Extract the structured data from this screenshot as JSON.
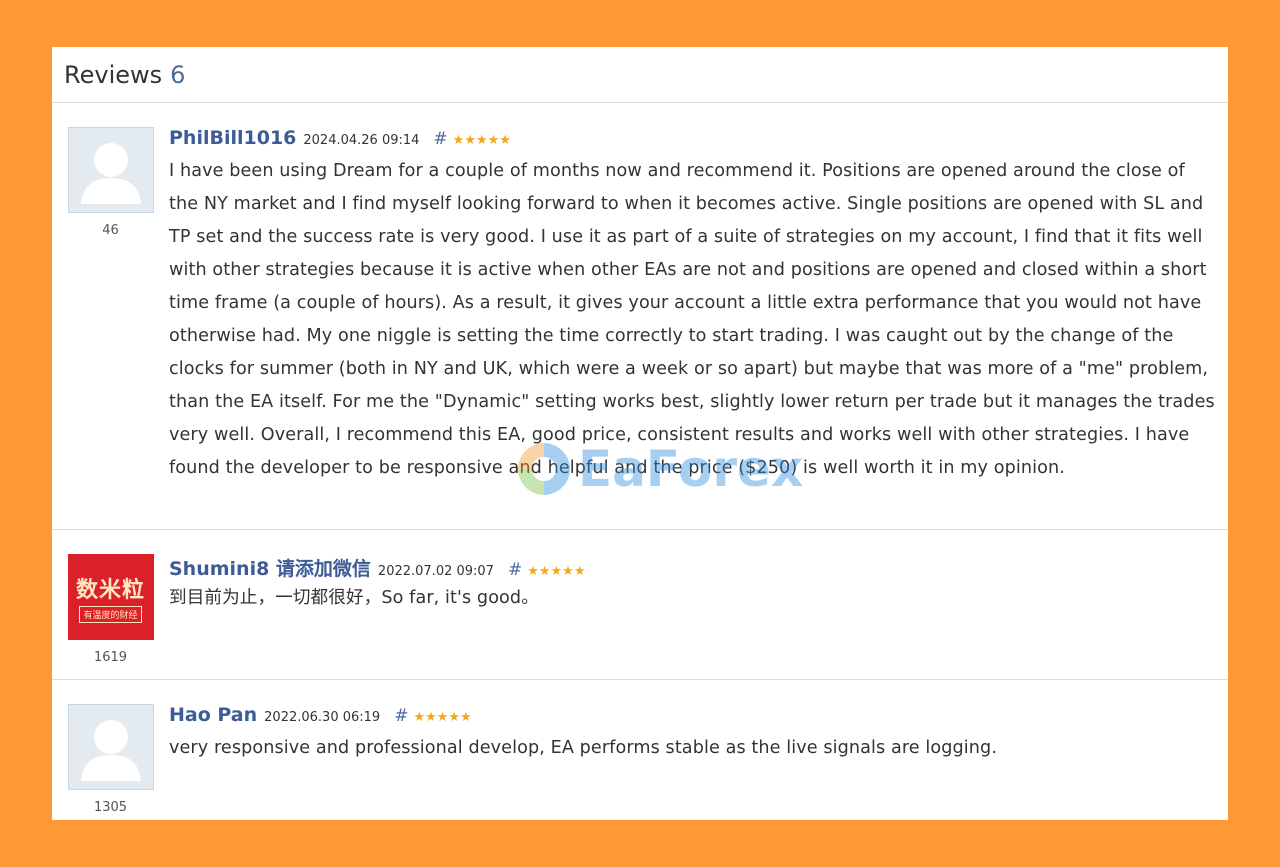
{
  "header": {
    "title": "Reviews",
    "count": "6"
  },
  "reviews": [
    {
      "author": "PhilBill1016",
      "date": "2024.04.26 09:14",
      "hash": "#",
      "stars": "★★★★★",
      "avatar_count": "46",
      "text": "I have been using Dream for a couple of months now and recommend it. Positions are opened around the close of the NY market and I find myself looking forward to when it becomes active. Single positions are opened with SL and TP set and the success rate is very good. I use it as part of a suite of strategies on my account, I find that it fits well with other strategies because it is active when other EAs are not and positions are opened and closed within a short time frame (a couple of hours). As a result, it gives your account a little extra performance that you would not have otherwise had. My one niggle is setting the time correctly to start trading. I was caught out by the change of the clocks for summer (both in NY and UK, which were a week or so apart) but maybe that was more of a \"me\" problem, than the EA itself. For me the \"Dynamic\" setting works best, slightly lower return per trade but it manages the trades very well. Overall, I recommend this EA, good price, consistent results and works well with other strategies. I have found the developer to be responsive and helpful and the price ($250) is well worth it in my opinion."
    },
    {
      "author": "Shumini8 请添加微信",
      "date": "2022.07.02 09:07",
      "hash": "#",
      "stars": "★★★★★",
      "avatar_count": "1619",
      "avatar_text_big": "数米粒",
      "avatar_text_small": "有温度的财经",
      "text": "到目前为止，一切都很好，So far, it's good。"
    },
    {
      "author": "Hao Pan",
      "date": "2022.06.30 06:19",
      "hash": "#",
      "stars": "★★★★★",
      "avatar_count": "1305",
      "text": "very responsive and professional develop, EA performs stable as the live signals are logging."
    }
  ],
  "watermark": {
    "text": "EaForex"
  },
  "colors": {
    "background": "#ff9933",
    "author": "#3d5b96",
    "stars": "#f0a81c"
  }
}
